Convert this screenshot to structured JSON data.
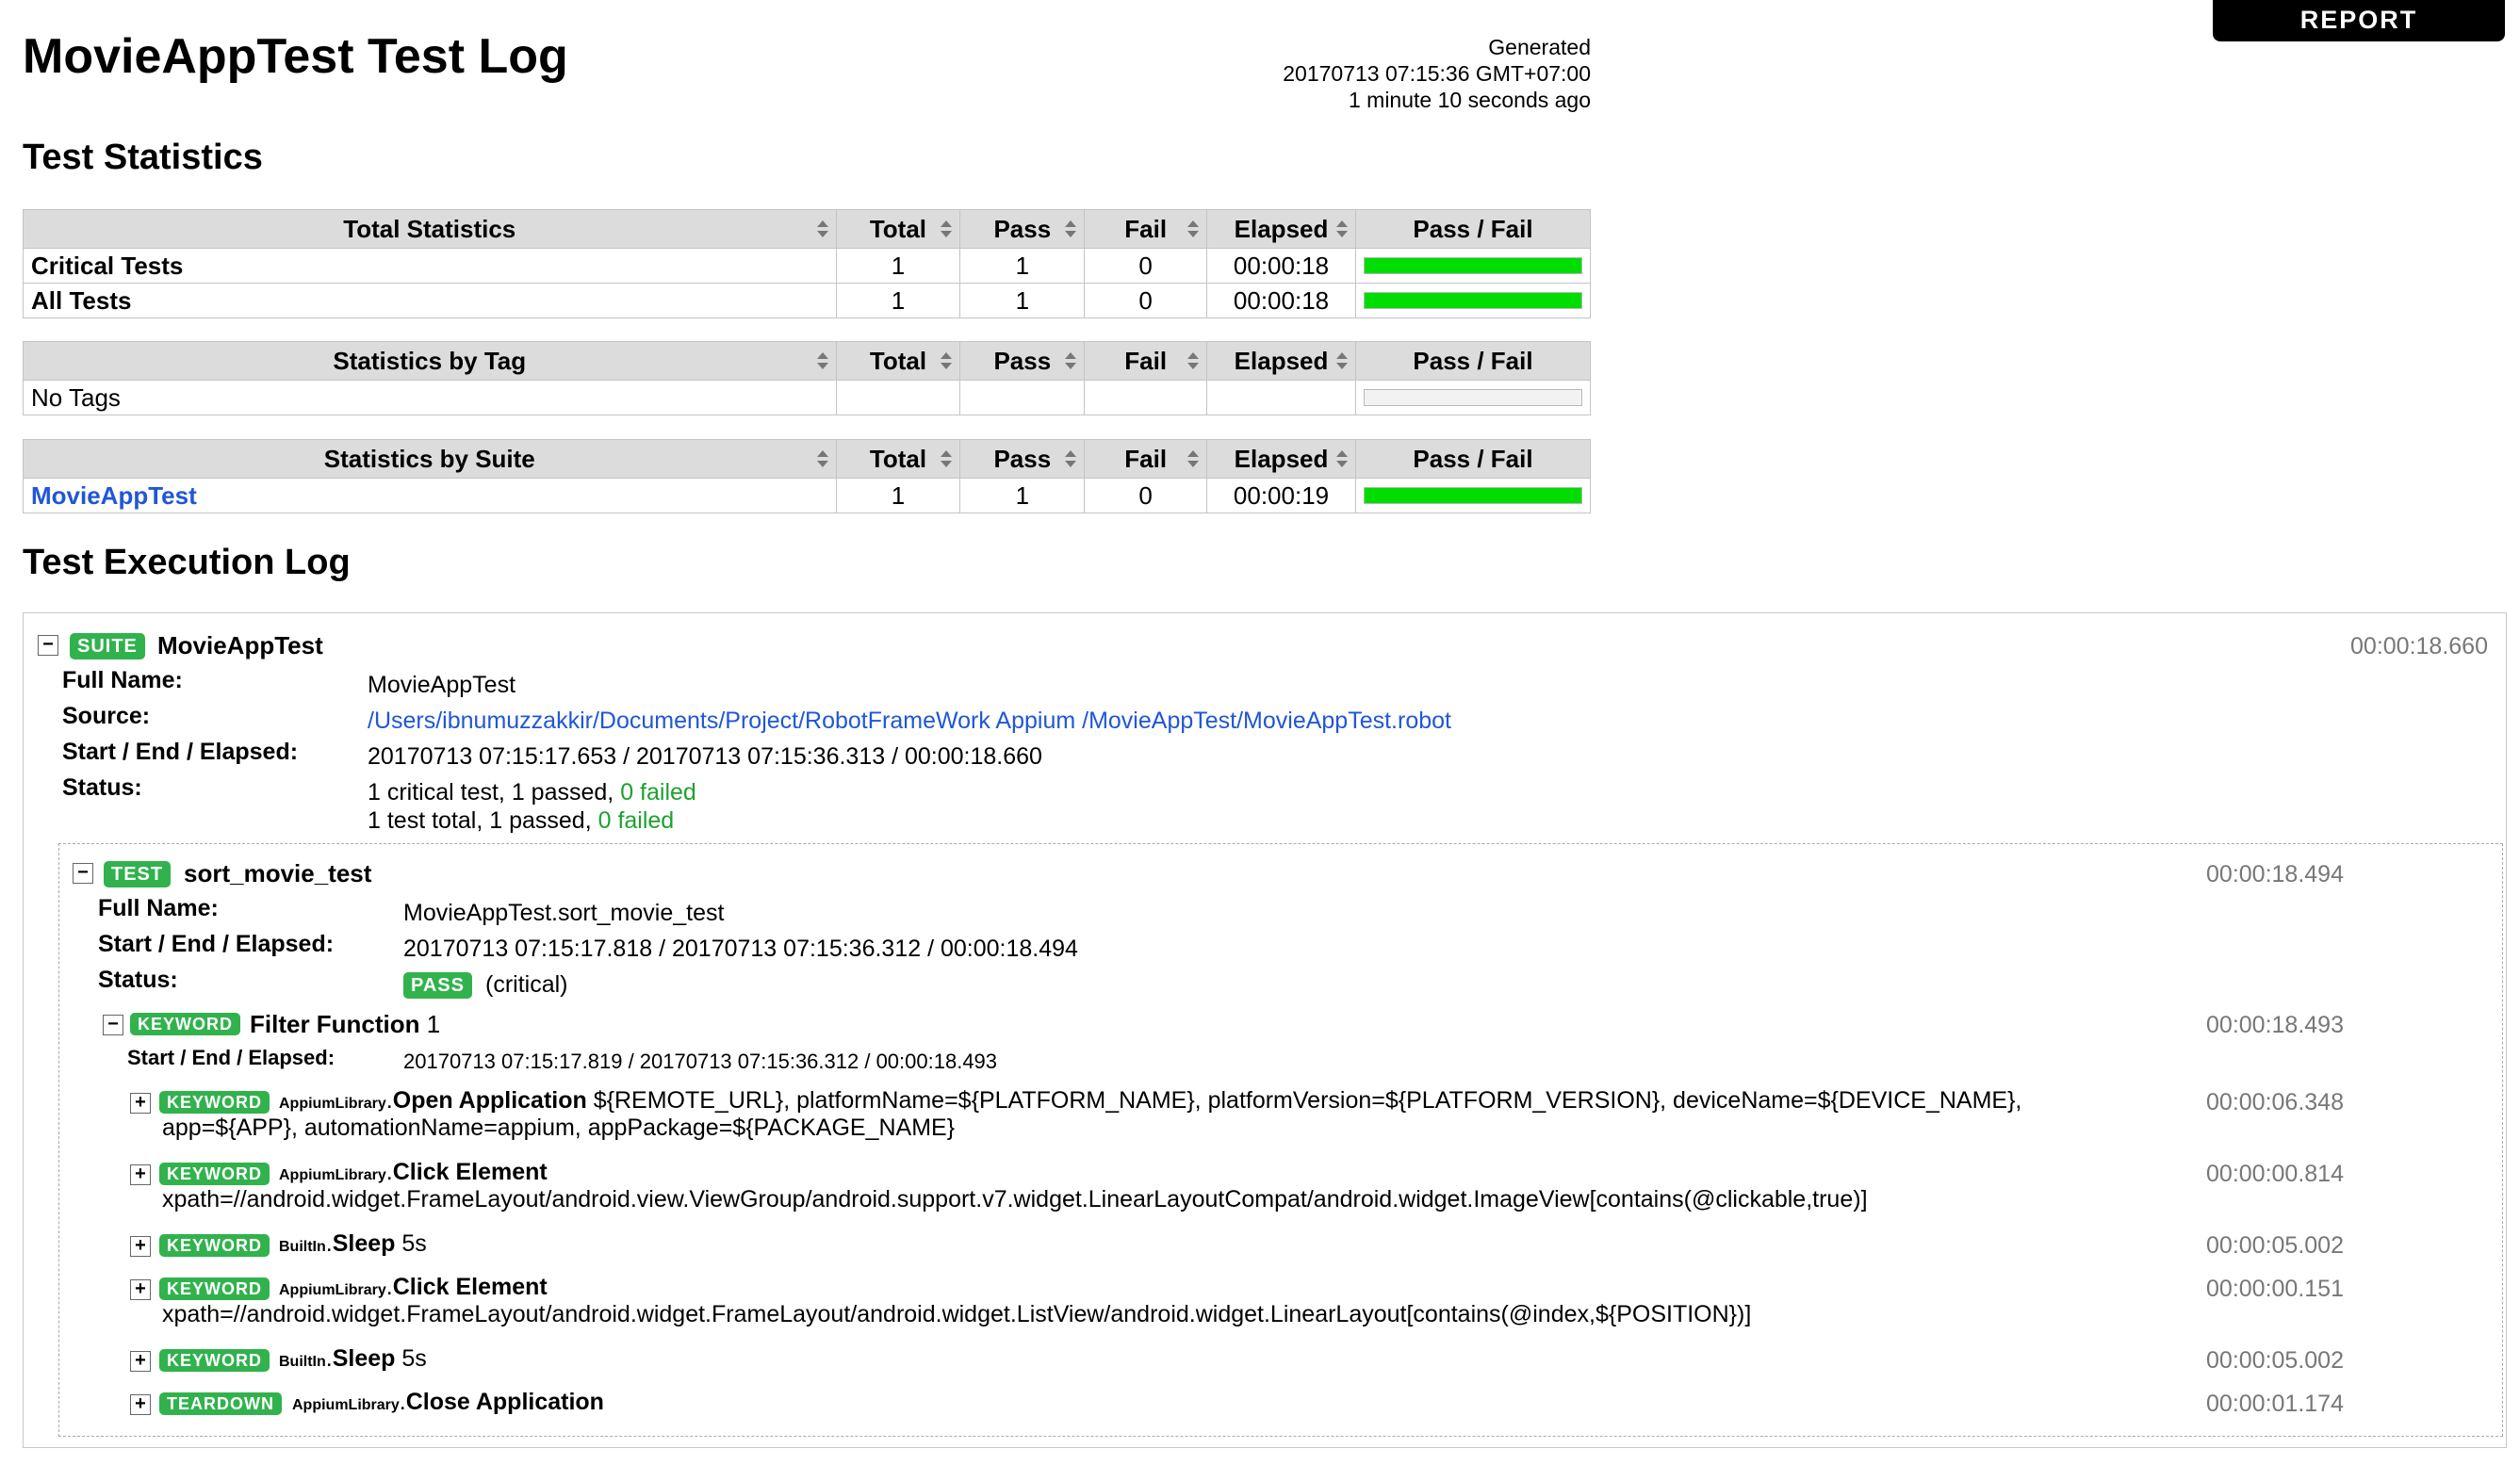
{
  "report_link": "REPORT",
  "title": "MovieAppTest Test Log",
  "generated": {
    "label": "Generated",
    "timestamp": "20170713 07:15:36 GMT+07:00",
    "ago": "1 minute 10 seconds ago"
  },
  "sections": {
    "statistics": "Test Statistics",
    "execution_log": "Test Execution Log"
  },
  "columns": {
    "total": "Total",
    "pass": "Pass",
    "fail": "Fail",
    "elapsed": "Elapsed",
    "pass_fail": "Pass / Fail"
  },
  "total_stats": {
    "header": "Total Statistics",
    "rows": [
      {
        "name": "Critical Tests",
        "total": "1",
        "pass": "1",
        "fail": "0",
        "elapsed": "00:00:18",
        "pass_ratio": 1.0
      },
      {
        "name": "All Tests",
        "total": "1",
        "pass": "1",
        "fail": "0",
        "elapsed": "00:00:18",
        "pass_ratio": 1.0
      }
    ]
  },
  "tag_stats": {
    "header": "Statistics by Tag",
    "rows": [
      {
        "name": "No Tags",
        "total": "",
        "pass": "",
        "fail": "",
        "elapsed": "",
        "pass_ratio": 0
      }
    ]
  },
  "suite_stats": {
    "header": "Statistics by Suite",
    "rows": [
      {
        "name": "MovieAppTest",
        "total": "1",
        "pass": "1",
        "fail": "0",
        "elapsed": "00:00:19",
        "pass_ratio": 1.0
      }
    ]
  },
  "meta_labels": {
    "full_name": "Full Name:",
    "source": "Source:",
    "start_end": "Start / End / Elapsed:",
    "status": "Status:"
  },
  "suite": {
    "label": "SUITE",
    "name": "MovieAppTest",
    "elapsed": "00:00:18.660",
    "full_name": "MovieAppTest",
    "source": "/Users/ibnumuzzakkir/Documents/Project/RobotFrameWork Appium /MovieAppTest/MovieAppTest.robot",
    "start_end": "20170713 07:15:17.653 / 20170713 07:15:36.313 / 00:00:18.660",
    "status_line1_prefix": "1 critical test, 1 passed, ",
    "status_line1_failed": "0 failed",
    "status_line2_prefix": "1 test total, 1 passed, ",
    "status_line2_failed": "0 failed"
  },
  "test": {
    "label": "TEST",
    "name": "sort_movie_test",
    "elapsed": "00:00:18.494",
    "full_name": "MovieAppTest.sort_movie_test",
    "start_end": "20170713 07:15:17.818 / 20170713 07:15:36.312 / 00:00:18.494",
    "status_badge": "PASS",
    "status_note": "(critical)"
  },
  "keyword": {
    "label": "KEYWORD",
    "name": "Filter Function",
    "args": "1",
    "elapsed": "00:00:18.493",
    "start_end_label": "Start / End / Elapsed:",
    "start_end": "20170713 07:15:17.819 / 20170713 07:15:36.312 / 00:00:18.493"
  },
  "sub_keywords": [
    {
      "label": "KEYWORD",
      "lib": "AppiumLibrary",
      "name": "Open Application",
      "args1": "${REMOTE_URL}, platformName=${PLATFORM_NAME}, platformVersion=${PLATFORM_VERSION}, deviceName=${DEVICE_NAME},",
      "args2": "app=${APP}, automationName=appium, appPackage=${PACKAGE_NAME}",
      "elapsed": "00:00:06.348"
    },
    {
      "label": "KEYWORD",
      "lib": "AppiumLibrary",
      "name": "Click Element",
      "args1": "",
      "args2": "xpath=//android.widget.FrameLayout/android.view.ViewGroup/android.support.v7.widget.LinearLayoutCompat/android.widget.ImageView[contains(@clickable,true)]",
      "elapsed": "00:00:00.814"
    },
    {
      "label": "KEYWORD",
      "lib": "BuiltIn",
      "name": "Sleep",
      "args1": "5s",
      "args2": "",
      "elapsed": "00:00:05.002"
    },
    {
      "label": "KEYWORD",
      "lib": "AppiumLibrary",
      "name": "Click Element",
      "args1": "",
      "args2": "xpath=//android.widget.FrameLayout/android.widget.FrameLayout/android.widget.ListView/android.widget.LinearLayout[contains(@index,${POSITION})]",
      "elapsed": "00:00:00.151"
    },
    {
      "label": "KEYWORD",
      "lib": "BuiltIn",
      "name": "Sleep",
      "args1": "5s",
      "args2": "",
      "elapsed": "00:00:05.002"
    },
    {
      "label": "TEARDOWN",
      "lib": "AppiumLibrary",
      "name": "Close Application",
      "args1": "",
      "args2": "",
      "elapsed": "00:00:01.174"
    }
  ],
  "colors": {
    "pass_green": "#00dd00",
    "label_green": "#31b24d",
    "link_blue": "#1f57d6"
  },
  "icons": {
    "expand": "plus-icon",
    "collapse": "minus-icon",
    "sort": "sort-icon"
  }
}
